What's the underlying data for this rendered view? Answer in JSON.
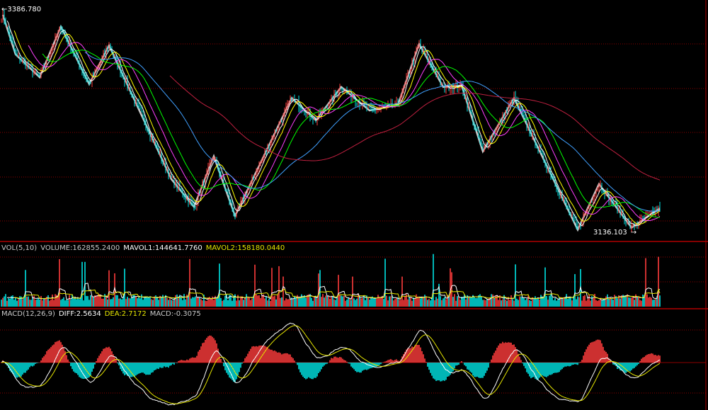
{
  "chart_data": {
    "type": "candlestick",
    "price_high_label": "3386.780",
    "price_low_label": "3136.103",
    "pivots": [
      {
        "i": 1,
        "p": 3384.4
      },
      {
        "i": 10,
        "p": 3338.7
      },
      {
        "i": 27,
        "p": 3312.3
      },
      {
        "i": 42,
        "p": 3370.8
      },
      {
        "i": 62,
        "p": 3304.3
      },
      {
        "i": 76,
        "p": 3349.1
      },
      {
        "i": 120,
        "p": 3194.6
      },
      {
        "i": 136,
        "p": 3162.5
      },
      {
        "i": 150,
        "p": 3221.0
      },
      {
        "i": 165,
        "p": 3152.1
      },
      {
        "i": 205,
        "p": 3288.3
      },
      {
        "i": 222,
        "p": 3262.6
      },
      {
        "i": 240,
        "p": 3301.1
      },
      {
        "i": 260,
        "p": 3273.9
      },
      {
        "i": 280,
        "p": 3280.3
      },
      {
        "i": 295,
        "p": 3350.7
      },
      {
        "i": 312,
        "p": 3301.1
      },
      {
        "i": 325,
        "p": 3302.7
      },
      {
        "i": 340,
        "p": 3226.6
      },
      {
        "i": 362,
        "p": 3288.3
      },
      {
        "i": 407,
        "p": 3136.1
      },
      {
        "i": 422,
        "p": 3188.9
      },
      {
        "i": 445,
        "p": 3138.5
      },
      {
        "i": 465,
        "p": 3160.9
      }
    ],
    "ylim": [
      3125,
      3395
    ],
    "ma_periods": [
      5,
      10,
      20,
      30,
      60,
      120
    ],
    "ma_colors": [
      "#ffffff",
      "#ffff00",
      "#ff40ff",
      "#00ff00",
      "#40a0ff",
      "#c02040"
    ],
    "volume": {
      "label": "VOL(5,10)",
      "volume": "VOLUME:162855.2400",
      "mavol1": "MAVOL1:144641.7760",
      "mavol2": "MAVOL2:158180.0440"
    },
    "macd": {
      "label": "MACD(12,26,9)",
      "diff": "DIFF:2.5634",
      "dea": "DEA:2.7172",
      "macd": "MACD:-0.3075"
    }
  },
  "colors": {
    "up": "#ff3c3c",
    "down": "#00e5e5",
    "grid": "#8b0000",
    "zigzag": "#c8c8c8",
    "text": "#c8c8c8",
    "yellow": "#e6e600"
  }
}
